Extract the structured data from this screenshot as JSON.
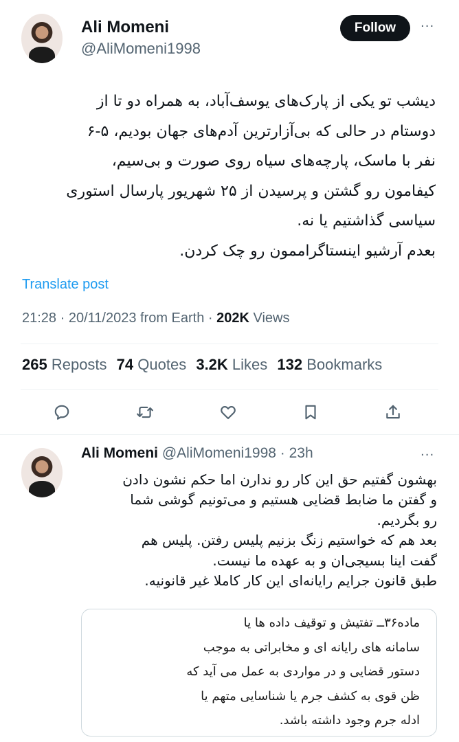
{
  "tweet": {
    "author_name": "Ali Momeni",
    "author_handle": "@AliMomeni1998",
    "follow_label": "Follow",
    "more_label": "···",
    "text_lines": [
      "دیشب تو یکی از پارک‌های یوسف‌آباد، به همراه دو تا از",
      "دوستام در حالی که بی‌آزارترین آدم‌های جهان بودیم، ۵-۶",
      "نفر با ماسک، پارچه‌های سیاه روی صورت و بی‌سیم،",
      "کیفامون رو گشتن و پرسیدن از ۲۵ شهریور پارسال استوری",
      "سیاسی گذاشتیم یا نه.",
      "بعدم آرشیو اینستاگراممون رو چک کردن."
    ],
    "translate_label": "Translate post",
    "timestamp": "21:28 · 20/11/2023 from Earth · ",
    "views_count": "202K",
    "views_label": " Views",
    "stats": {
      "reposts_count": "265",
      "reposts_label": " Repost",
      "quotes_count": "74",
      "quotes_label": " Quotes",
      "likes_count": "3.2K",
      "likes_label": " Likes",
      "bookmarks_count": "132",
      "bookmarks_label": " Bookmarks"
    },
    "action_icons": [
      "reply-icon",
      "repost-icon",
      "like-icon",
      "bookmark-icon",
      "share-icon"
    ]
  },
  "reply": {
    "author_name": "Ali Momeni",
    "author_handle": "@AliMomeni1998",
    "time": " · 23h",
    "more_label": "···",
    "text_lines": [
      "بهشون گفتیم حق این کار رو ندارن اما حکم نشون دادن",
      "و گفتن ما ضابط قضایی هستیم و می‌تونیم گوشی شما",
      "رو بگردیم.",
      "بعد هم که خواستیم زنگ بزنیم پلیس رفتن. پلیس هم",
      "گفت اینا بسیجی‌ان و به عهده ما نیست.",
      "طبق قانون جرایم رایانه‌ای این کار کاملا غیر قانونیه."
    ],
    "quote_lines": [
      "ماده۳۶ــ تفتیش و توقیف داده ها یا",
      "سامانه های رایانه ای و مخابراتی به موجب",
      "دستور قضایی و در مواردی به عمل می آید که",
      "ظن قوی به کشف جرم یا شناسایی متهم یا",
      "ادله جرم وجود داشته باشد."
    ]
  },
  "colors": {
    "text": "#0f1419",
    "secondary": "#536471",
    "link": "#1d9bf0",
    "button": "#0f1419"
  }
}
